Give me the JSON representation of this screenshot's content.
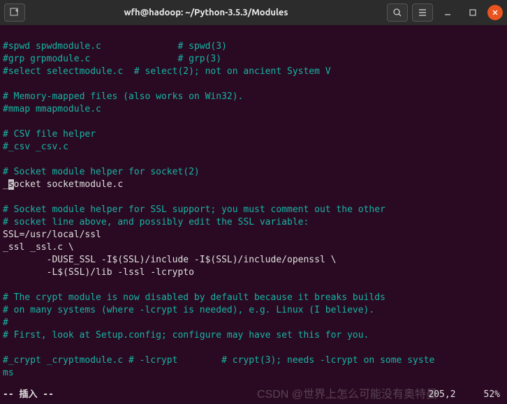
{
  "titlebar": {
    "title": "wfh@hadoop: ~/Python-3.5.3/Modules",
    "new_tab_icon": "new-tab",
    "search_icon": "search",
    "menu_icon": "hamburger",
    "minimize_icon": "minimize",
    "maximize_icon": "maximize",
    "close_icon": "close"
  },
  "lines": {
    "l1a": "#spwd spwdmodule.c",
    "l1b": "# spwd(3)",
    "l2a": "#grp grpmodule.c",
    "l2b": "# grp(3)",
    "l3a": "#select selectmodule.c",
    "l3b": "# select(2); not on ancient System V",
    "l4": "# Memory-mapped files (also works on Win32).",
    "l5": "#mmap mmapmodule.c",
    "l6": "# CSV file helper",
    "l7": "#_csv _csv.c",
    "l8": "# Socket module helper for socket(2)",
    "l9a": "_",
    "l9b": "s",
    "l9c": "ocket socketmodule.c",
    "l10": "# Socket module helper for SSL support; you must comment out the other",
    "l11": "# socket line above, and possibly edit the SSL variable:",
    "l12": "SSL=/usr/local/ssl",
    "l13": "_ssl _ssl.c \\",
    "l14": "        -DUSE_SSL -I$(SSL)/include -I$(SSL)/include/openssl \\",
    "l15": "        -L$(SSL)/lib -lssl -lcrypto",
    "l16": "# The crypt module is now disabled by default because it breaks builds",
    "l17": "# on many systems (where -lcrypt is needed), e.g. Linux (I believe).",
    "l18": "#",
    "l19": "# First, look at Setup.config; configure may have set this for you.",
    "l20a": "#_crypt _cryptmodule.c",
    "l20b": "# -lcrypt",
    "l20c": "# crypt(3); needs -lcrypt on some syste",
    "l20d": "ms"
  },
  "status": {
    "mode": "-- 插入 --",
    "pos1": "205,2",
    "pos2": "52%"
  },
  "watermark": "CSDN @世界上怎么可能没有奥特曼"
}
